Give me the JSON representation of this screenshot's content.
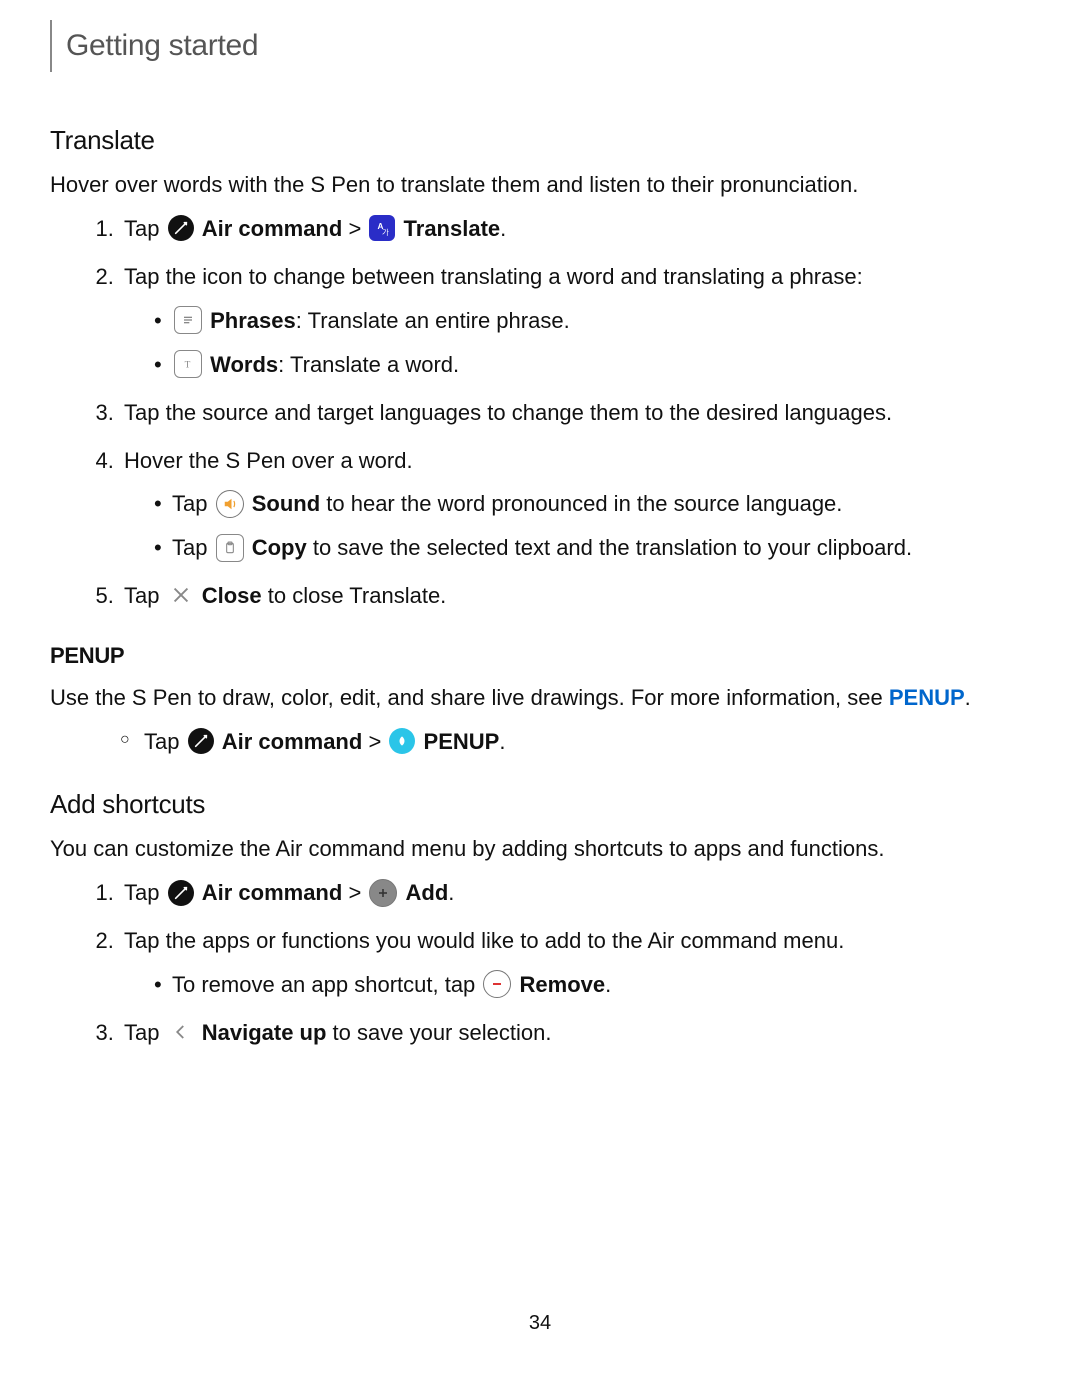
{
  "breadcrumb": "Getting started",
  "translate": {
    "heading": "Translate",
    "intro": "Hover over words with the S Pen to translate them and listen to their pronunciation.",
    "step1_a": "Tap ",
    "step1_b": "Air command",
    "step1_c": " > ",
    "step1_d": "Translate",
    "step1_e": ".",
    "step2": "Tap the icon to change between translating a word and translating a phrase:",
    "step2_sub1_b": "Phrases",
    "step2_sub1_t": ": Translate an entire phrase.",
    "step2_sub2_b": "Words",
    "step2_sub2_t": ": Translate a word.",
    "step3": "Tap the source and target languages to change them to the desired languages.",
    "step4": "Hover the S Pen over a word.",
    "step4_sub1_a": "Tap ",
    "step4_sub1_b": "Sound",
    "step4_sub1_t": " to hear the word pronounced in the source language.",
    "step4_sub2_a": "Tap ",
    "step4_sub2_b": "Copy",
    "step4_sub2_t": " to save the selected text and the translation to your clipboard.",
    "step5_a": "Tap ",
    "step5_b": "Close",
    "step5_t": " to close Translate."
  },
  "penup": {
    "heading": "PENUP",
    "intro_a": "Use the S Pen to draw, color, edit, and share live drawings. For more information, see ",
    "link": "PENUP",
    "intro_b": ".",
    "step_a": "Tap ",
    "step_b": "Air command",
    "step_c": " > ",
    "step_d": "PENUP",
    "step_e": "."
  },
  "shortcuts": {
    "heading": "Add shortcuts",
    "intro": "You can customize the Air command menu by adding shortcuts to apps and functions.",
    "s1_a": "Tap ",
    "s1_b": "Air command",
    "s1_c": " > ",
    "s1_d": "Add",
    "s1_e": ".",
    "s2": "Tap the apps or functions you would like to add to the Air command menu.",
    "s2_sub_a": "To remove an app shortcut, tap ",
    "s2_sub_b": "Remove",
    "s2_sub_c": ".",
    "s3_a": "Tap ",
    "s3_b": "Navigate up",
    "s3_t": " to save your selection."
  },
  "page": "34"
}
